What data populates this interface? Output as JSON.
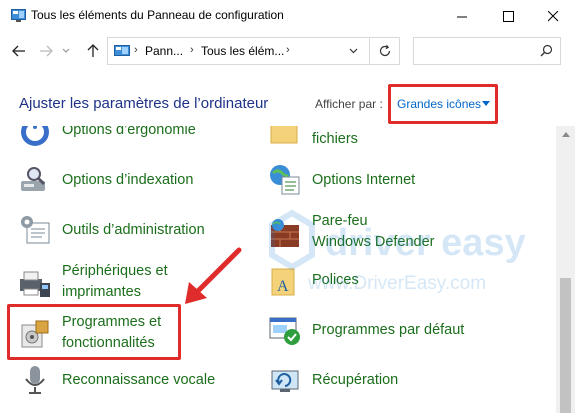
{
  "window": {
    "title": "Tous les éléments du Panneau de configuration"
  },
  "address": {
    "crumbs": [
      "Pann...",
      "Tous les élém..."
    ],
    "search_placeholder": ""
  },
  "header": {
    "heading": "Ajuster les paramètres de l’ordinateur",
    "view_label": "Afficher par :",
    "view_value": "Grandes icônes"
  },
  "items_left": [
    {
      "label": "Options d’ergonomie",
      "icon": "ergonomics-icon"
    },
    {
      "label": "Options d’indexation",
      "icon": "indexing-icon"
    },
    {
      "label": "Outils d’administration",
      "icon": "admin-tools-icon"
    },
    {
      "label": "Périphériques et",
      "label2": "imprimantes",
      "icon": "printer-icon"
    },
    {
      "label": "Programmes et",
      "label2": "fonctionnalités",
      "icon": "programs-icon"
    },
    {
      "label": "Reconnaissance vocale",
      "icon": "microphone-icon"
    }
  ],
  "items_right": [
    {
      "label": "fichiers",
      "icon": "folder-icon"
    },
    {
      "label": "Options Internet",
      "icon": "internet-options-icon"
    },
    {
      "label": "Pare-feu",
      "label2": "Windows Defender",
      "icon": "firewall-icon"
    },
    {
      "label": "Polices",
      "icon": "fonts-icon"
    },
    {
      "label": "Programmes par défaut",
      "icon": "default-programs-icon"
    },
    {
      "label": "Récupération",
      "icon": "recovery-icon"
    }
  ],
  "watermark": {
    "brand": "driver easy",
    "url": "www.DriverEasy.com"
  },
  "colors": {
    "link_green": "#1b6e1b",
    "heading_blue": "#1e3287",
    "highlight_red": "#e02b2b"
  }
}
